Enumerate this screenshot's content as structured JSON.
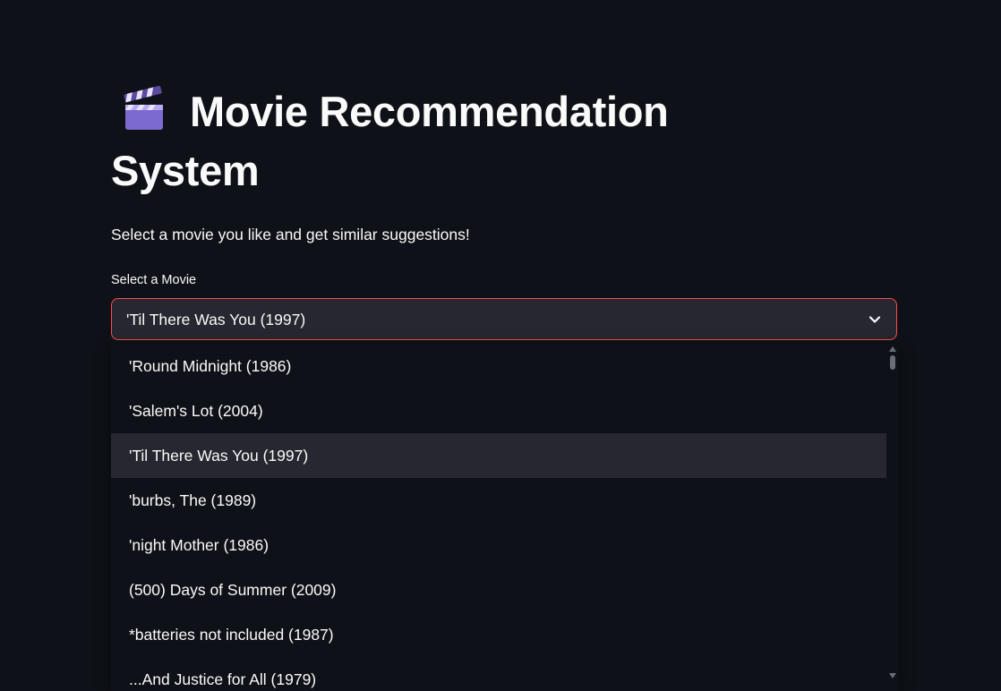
{
  "app": {
    "title_emoji": "clapper-board-icon",
    "title": "Movie Recommendation System",
    "subtitle": "Select a movie you like and get similar suggestions!"
  },
  "movie_select": {
    "label": "Select a Movie",
    "selected_value": "'Til There Was You (1997)",
    "accent_color": "#ff4b4b",
    "highlighted_index": 2,
    "options": [
      "'Round Midnight (1986)",
      "'Salem's Lot (2004)",
      "'Til There Was You (1997)",
      "'burbs, The (1989)",
      "'night Mother (1986)",
      "(500) Days of Summer (2009)",
      "*batteries not included (1987)",
      "...And Justice for All (1979)"
    ]
  },
  "colors": {
    "background": "#0e1117",
    "input_background": "#262730",
    "text": "#fafafa"
  }
}
